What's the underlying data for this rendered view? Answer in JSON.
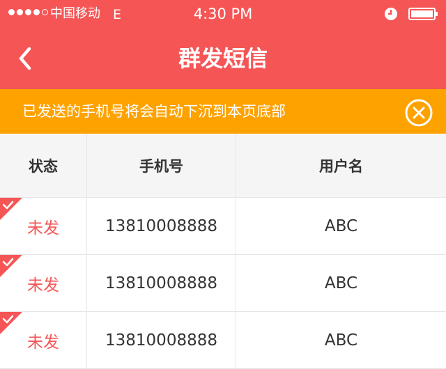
{
  "status_bar": {
    "carrier": "中国移动",
    "network": "E",
    "time": "4:30 PM",
    "signal_icon": "signal-dots-icon",
    "alarm_icon": "clock-icon",
    "battery_icon": "battery-icon"
  },
  "nav": {
    "title": "群发短信",
    "back_icon": "chevron-left-icon"
  },
  "notice": {
    "text": "已发送的手机号将会自动下沉到本页底部",
    "close_icon": "close-circle-icon"
  },
  "table": {
    "headers": [
      "状态",
      "手机号",
      "用户名"
    ],
    "rows": [
      {
        "status": "未发",
        "phone": "13810008888",
        "username": "ABC"
      },
      {
        "status": "未发",
        "phone": "13810008888",
        "username": "ABC"
      },
      {
        "status": "未发",
        "phone": "13810008888",
        "username": "ABC"
      }
    ]
  },
  "colors": {
    "header_bg": "#f65556",
    "notice_bg": "#fea200",
    "status_text": "#f65556",
    "table_header_bg": "#f5f5f5"
  }
}
